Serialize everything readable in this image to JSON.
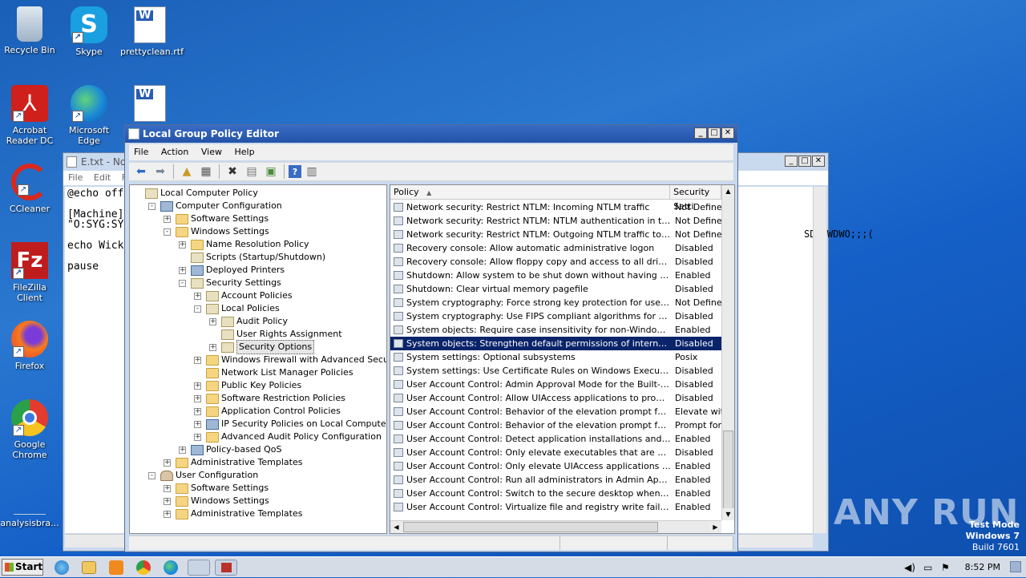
{
  "desktop": {
    "icons": [
      {
        "label": "Recycle Bin"
      },
      {
        "label": "Skype"
      },
      {
        "label": "prettyclean.rtf"
      },
      {
        "label": "Acrobat Reader DC"
      },
      {
        "label": "Microsoft Edge"
      },
      {
        "label": "CCleaner"
      },
      {
        "label": "FileZilla Client"
      },
      {
        "label": "Firefox"
      },
      {
        "label": "Google Chrome"
      },
      {
        "label": "analysisbra..."
      }
    ],
    "watermark": {
      "line1": "Test Mode",
      "line2": "Windows 7",
      "line3": "Build 7601"
    },
    "brand": "ANY RUN"
  },
  "notepad": {
    "title": "E.txt - Not",
    "menu": [
      "File",
      "Edit",
      "Fo"
    ],
    "lines": [
      "@echo off",
      "",
      "[Machine]",
      "\"O:SYG:SY",
      "",
      "echo Wick",
      "",
      "pause"
    ],
    "right_text": "SDRCWDWO;;;("
  },
  "gpedit": {
    "title": "Local Group Policy Editor",
    "menu": [
      "File",
      "Action",
      "View",
      "Help"
    ],
    "tree": [
      {
        "label": "Local Computer Policy"
      },
      {
        "label": "Computer Configuration"
      },
      {
        "label": "Software Settings"
      },
      {
        "label": "Windows Settings"
      },
      {
        "label": "Name Resolution Policy"
      },
      {
        "label": "Scripts (Startup/Shutdown)"
      },
      {
        "label": "Deployed Printers"
      },
      {
        "label": "Security Settings"
      },
      {
        "label": "Account Policies"
      },
      {
        "label": "Local Policies"
      },
      {
        "label": "Audit Policy"
      },
      {
        "label": "User Rights Assignment"
      },
      {
        "label": "Security Options"
      },
      {
        "label": "Windows Firewall with Advanced Security"
      },
      {
        "label": "Network List Manager Policies"
      },
      {
        "label": "Public Key Policies"
      },
      {
        "label": "Software Restriction Policies"
      },
      {
        "label": "Application Control Policies"
      },
      {
        "label": "IP Security Policies on Local Computer"
      },
      {
        "label": "Advanced Audit Policy Configuration"
      },
      {
        "label": "Policy-based QoS"
      },
      {
        "label": "Administrative Templates"
      },
      {
        "label": "User Configuration"
      },
      {
        "label": "Software Settings"
      },
      {
        "label": "Windows Settings"
      },
      {
        "label": "Administrative Templates"
      }
    ],
    "columns": {
      "policy": "Policy",
      "setting": "Security Setti"
    },
    "rows": [
      {
        "policy": "Network security: Restrict NTLM: Incoming NTLM traffic",
        "setting": "Not Defined"
      },
      {
        "policy": "Network security: Restrict NTLM: NTLM authentication in this dom...",
        "setting": "Not Defined"
      },
      {
        "policy": "Network security: Restrict NTLM: Outgoing NTLM traffic to remot...",
        "setting": "Not Defined"
      },
      {
        "policy": "Recovery console: Allow automatic administrative logon",
        "setting": "Disabled"
      },
      {
        "policy": "Recovery console: Allow floppy copy and access to all drives and ...",
        "setting": "Disabled"
      },
      {
        "policy": "Shutdown: Allow system to be shut down without having to log on",
        "setting": "Enabled"
      },
      {
        "policy": "Shutdown: Clear virtual memory pagefile",
        "setting": "Disabled"
      },
      {
        "policy": "System cryptography: Force strong key protection for user keys ...",
        "setting": "Not Defined"
      },
      {
        "policy": "System cryptography: Use FIPS compliant algorithms for encrypti...",
        "setting": "Disabled"
      },
      {
        "policy": "System objects: Require case insensitivity for non-Windows subs...",
        "setting": "Enabled"
      },
      {
        "policy": "System objects: Strengthen default permissions of internal syste...",
        "setting": "Disabled"
      },
      {
        "policy": "System settings: Optional subsystems",
        "setting": "Posix"
      },
      {
        "policy": "System settings: Use Certificate Rules on Windows Executables f...",
        "setting": "Disabled"
      },
      {
        "policy": "User Account Control: Admin Approval Mode for the Built-in Admi...",
        "setting": "Disabled"
      },
      {
        "policy": "User Account Control: Allow UIAccess applications to prompt for ...",
        "setting": "Disabled"
      },
      {
        "policy": "User Account Control: Behavior of the elevation prompt for admi...",
        "setting": "Elevate with"
      },
      {
        "policy": "User Account Control: Behavior of the elevation prompt for stand...",
        "setting": "Prompt for c"
      },
      {
        "policy": "User Account Control: Detect application installations and prompt...",
        "setting": "Enabled"
      },
      {
        "policy": "User Account Control: Only elevate executables that are signed ...",
        "setting": "Disabled"
      },
      {
        "policy": "User Account Control: Only elevate UIAccess applications that ar...",
        "setting": "Enabled"
      },
      {
        "policy": "User Account Control: Run all administrators in Admin Approval M...",
        "setting": "Enabled"
      },
      {
        "policy": "User Account Control: Switch to the secure desktop when prompt...",
        "setting": "Enabled"
      },
      {
        "policy": "User Account Control: Virtualize file and registry write failures to ...",
        "setting": "Enabled"
      }
    ]
  },
  "taskbar": {
    "start": "Start",
    "clock": "8:52 PM"
  }
}
